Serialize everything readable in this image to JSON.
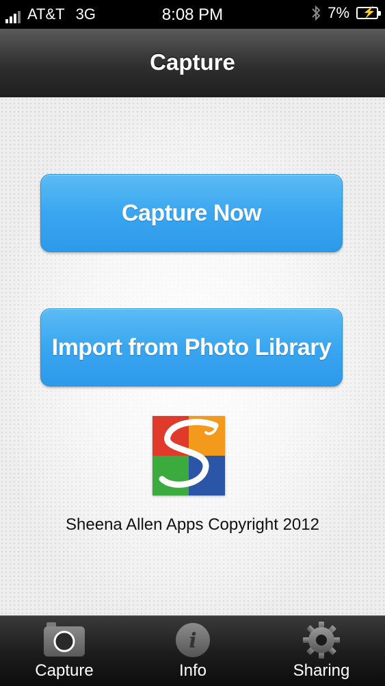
{
  "status_bar": {
    "carrier": "AT&T",
    "network": "3G",
    "time": "8:08 PM",
    "battery": "7%"
  },
  "nav": {
    "title": "Capture"
  },
  "main": {
    "capture_now_label": "Capture Now",
    "import_label": "Import from Photo Library",
    "copyright": "Sheena Allen Apps Copyright 2012"
  },
  "tabs": [
    {
      "label": "Capture",
      "icon": "camera-icon"
    },
    {
      "label": "Info",
      "icon": "info-icon"
    },
    {
      "label": "Sharing",
      "icon": "gear-icon"
    }
  ],
  "colors": {
    "button_blue": "#3aa6f0",
    "nav_dark": "#2e2e2e",
    "logo_red": "#e03a2c",
    "logo_orange": "#f39a1c",
    "logo_green": "#3cab3e",
    "logo_blue": "#2b56a8"
  }
}
